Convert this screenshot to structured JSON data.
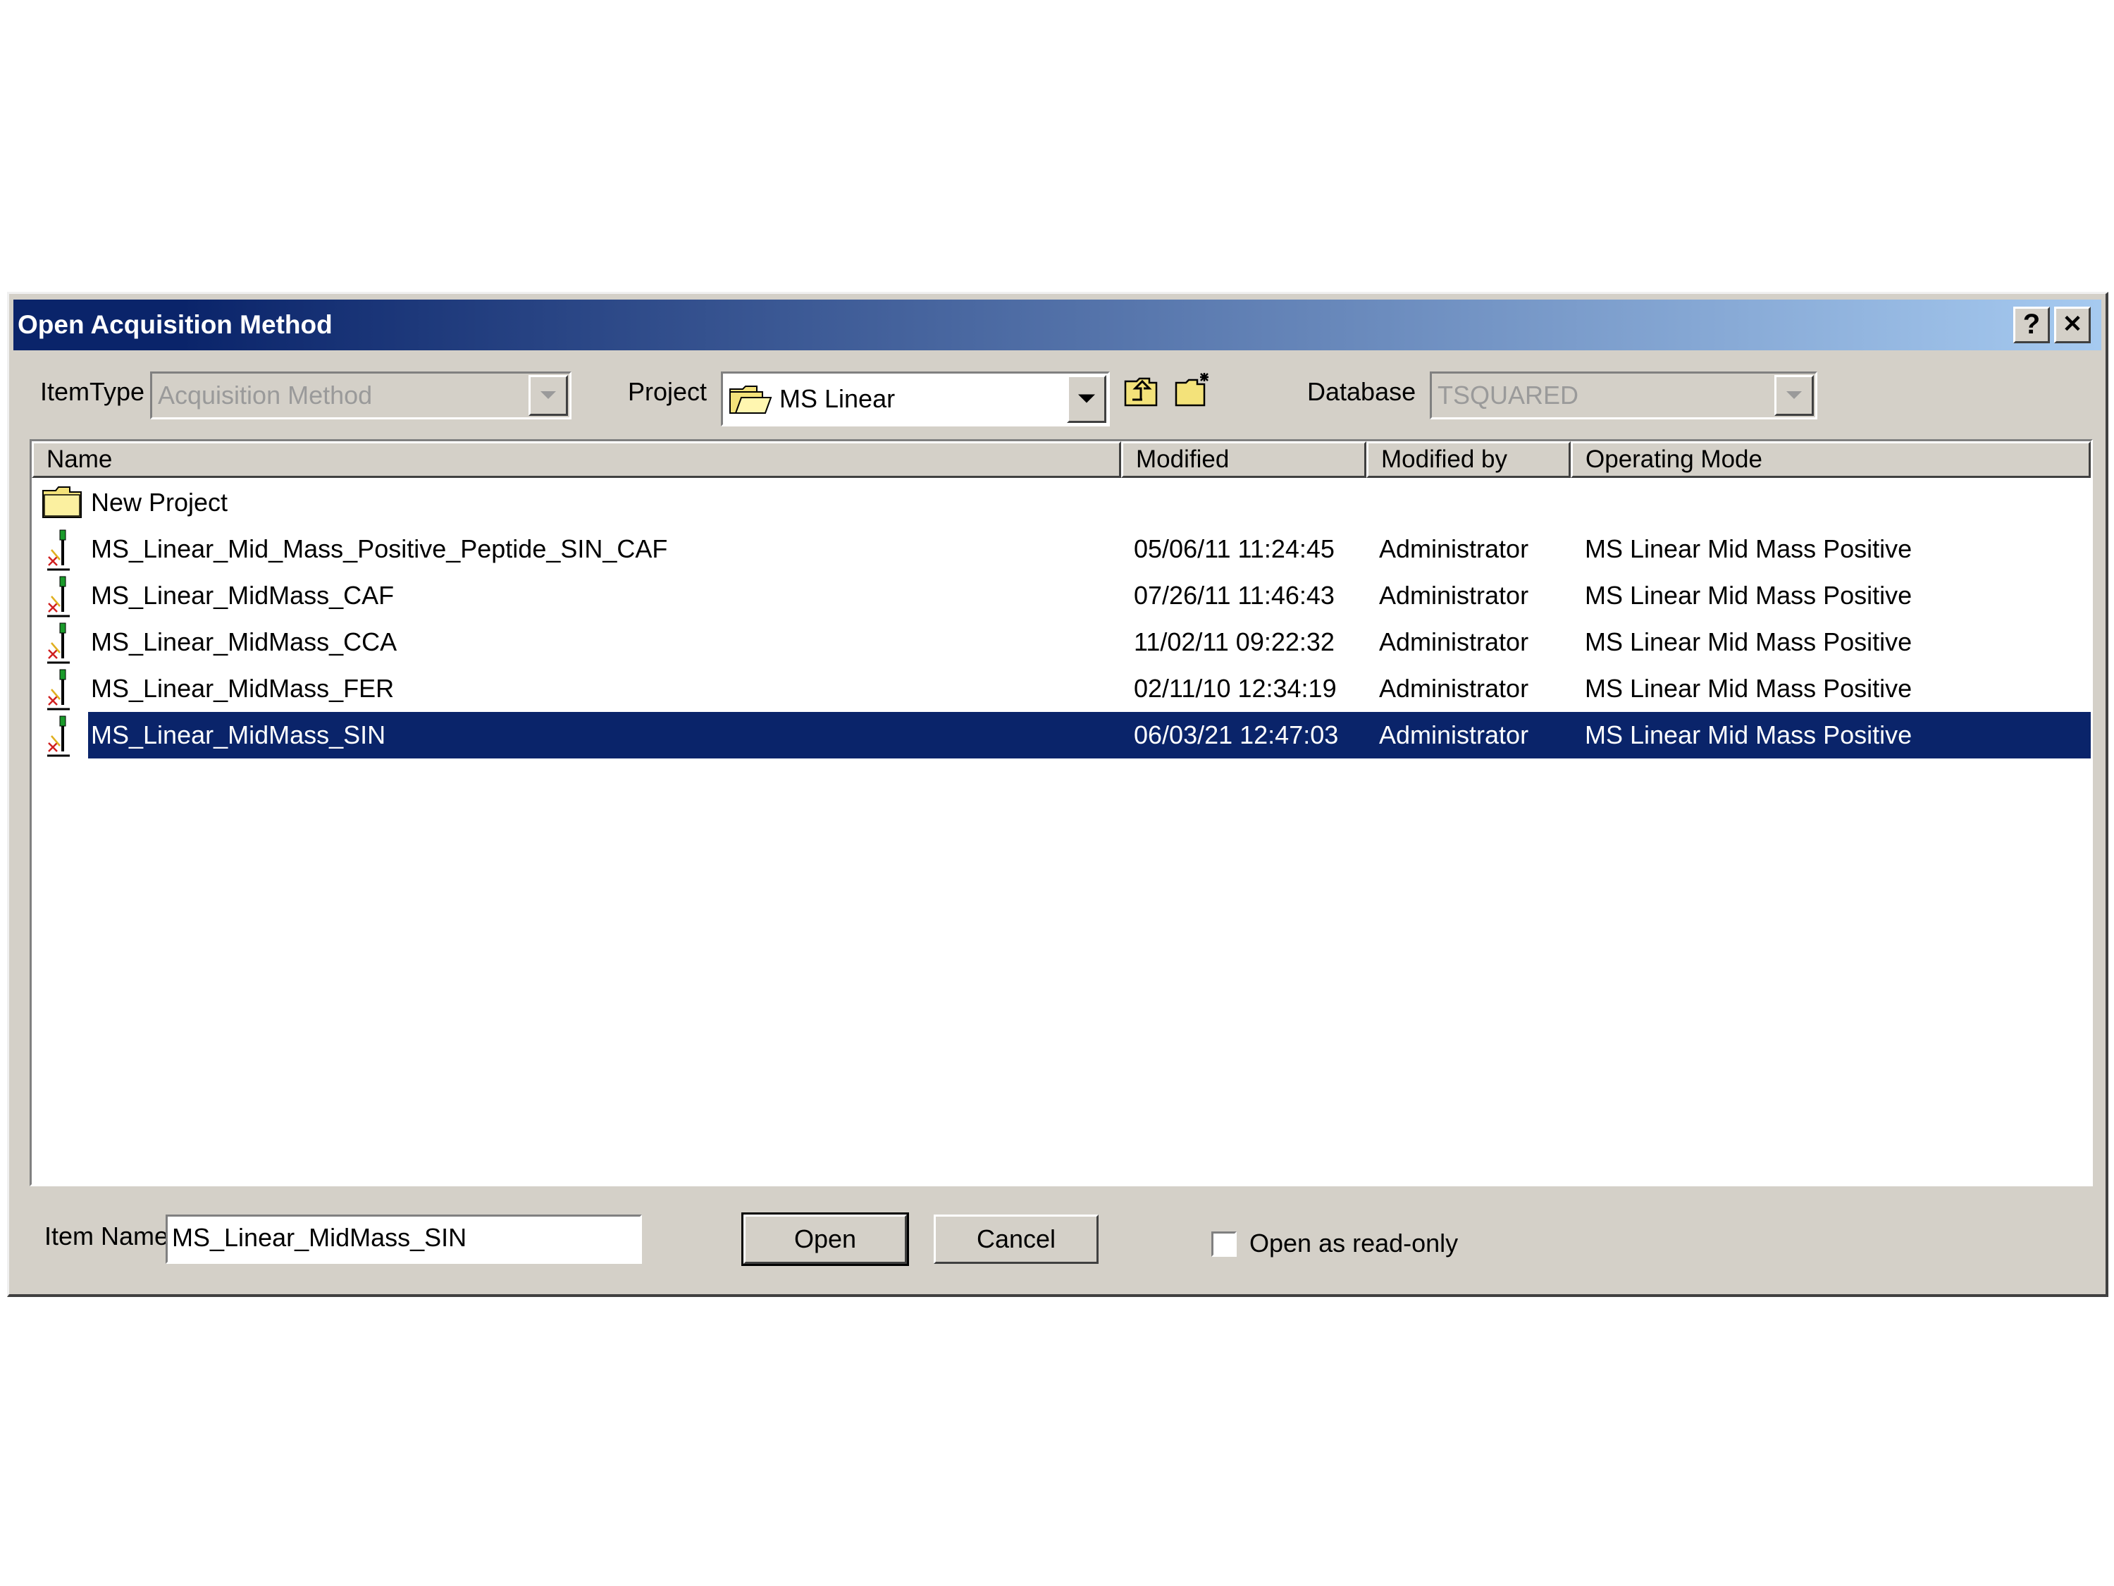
{
  "dialog": {
    "title": "Open Acquisition Method",
    "help_label": "?",
    "close_label": "✕"
  },
  "toolbar": {
    "itemtype_label": "ItemType",
    "itemtype_value": "Acquisition Method",
    "project_label": "Project",
    "project_value": "MS Linear",
    "database_label": "Database",
    "database_value": "TSQUARED"
  },
  "list": {
    "columns": [
      "Name",
      "Modified",
      "Modified by",
      "Operating Mode"
    ],
    "rows": [
      {
        "name": "New Project",
        "modified": "",
        "modified_by": "",
        "mode": "",
        "icon": "folder-icon"
      },
      {
        "name": "MS_Linear_Mid_Mass_Positive_Peptide_SIN_CAF",
        "modified": "05/06/11 11:24:45",
        "modified_by": "Administrator",
        "mode": "MS Linear Mid Mass Positive",
        "icon": "method-icon"
      },
      {
        "name": "MS_Linear_MidMass_CAF",
        "modified": "07/26/11 11:46:43",
        "modified_by": "Administrator",
        "mode": "MS Linear Mid Mass Positive",
        "icon": "method-icon"
      },
      {
        "name": "MS_Linear_MidMass_CCA",
        "modified": "11/02/11 09:22:32",
        "modified_by": "Administrator",
        "mode": "MS Linear Mid Mass Positive",
        "icon": "method-icon"
      },
      {
        "name": "MS_Linear_MidMass_FER",
        "modified": "02/11/10 12:34:19",
        "modified_by": "Administrator",
        "mode": "MS Linear Mid Mass Positive",
        "icon": "method-icon"
      },
      {
        "name": "MS_Linear_MidMass_SIN",
        "modified": "06/03/21 12:47:03",
        "modified_by": "Administrator",
        "mode": "MS Linear Mid Mass Positive",
        "icon": "method-icon",
        "selected": true
      }
    ]
  },
  "footer": {
    "item_name_label": "Item Name",
    "item_name_value": "MS_Linear_MidMass_SIN",
    "open_label": "Open",
    "cancel_label": "Cancel",
    "readonly_label": "Open as read-only",
    "readonly_checked": false
  },
  "colors": {
    "titlebar_start": "#0a246a",
    "titlebar_end": "#a6caf0",
    "selection": "#0a246a",
    "dialog_face": "#d4d0c8"
  }
}
